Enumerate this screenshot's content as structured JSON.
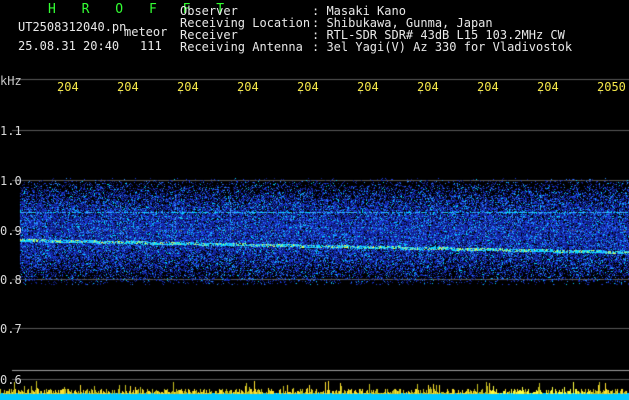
{
  "header": {
    "title": "H R O F F T",
    "filename": "UT2508312040.pn",
    "filename_tag": "meteor",
    "datetime": "25.08.31 20:40",
    "count": "111",
    "fields": [
      {
        "label": "Observer",
        "value": ": Masaki Kano"
      },
      {
        "label": "Receiving Location",
        "value": ": Shibukawa, Gunma, Japan"
      },
      {
        "label": "Receiver",
        "value": ": RTL-SDR SDR# 43dB L15 103.2MHz CW"
      },
      {
        "label": "Receiving Antenna",
        "value": ": 3el Yagi(V) Az 330 for Vladivostok"
      }
    ]
  },
  "axis": {
    "y_unit": "kHz",
    "y_ticks": [
      "1.1",
      "1.0",
      "0.9",
      "0.8",
      "0.7",
      "0.6"
    ],
    "x_ticks": [
      "204",
      "204",
      "204",
      "204",
      "204",
      "204",
      "204",
      "204",
      "204",
      "2050"
    ]
  },
  "colors": {
    "background": "#000000",
    "header_title": "#33ff33",
    "header_text": "#e8e8e8",
    "tick_labels": "#f4e84a",
    "noise_low": "#1a2fd8",
    "noise_high": "#00e0ff",
    "meteor_trace": "#ffff40"
  }
}
